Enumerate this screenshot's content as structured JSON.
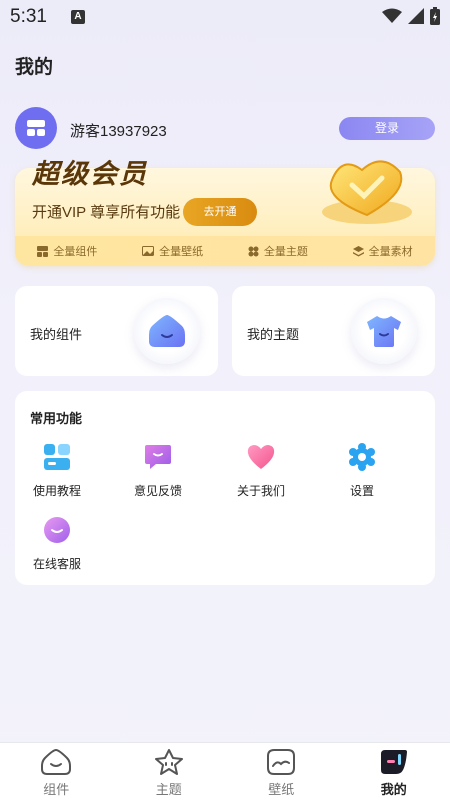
{
  "status_bar": {
    "time": "5:31",
    "notification_letter": "A"
  },
  "page_title": "我的",
  "user": {
    "name": "游客13937923",
    "login_label": "登录"
  },
  "vip": {
    "title": "超级会员",
    "subtitle": "开通VIP 尊享所有功能",
    "open_label": "去开通",
    "benefits": [
      "全量组件",
      "全量壁纸",
      "全量主题",
      "全量素材"
    ]
  },
  "cards": {
    "widgets_label": "我的组件",
    "themes_label": "我的主题"
  },
  "functions": {
    "title": "常用功能",
    "items": [
      "使用教程",
      "意见反馈",
      "关于我们",
      "设置",
      "在线客服"
    ]
  },
  "tabs": [
    "组件",
    "主题",
    "壁纸",
    "我的"
  ],
  "colors": {
    "accent": "#7b78f0",
    "vip_gold": "#e8a623"
  }
}
